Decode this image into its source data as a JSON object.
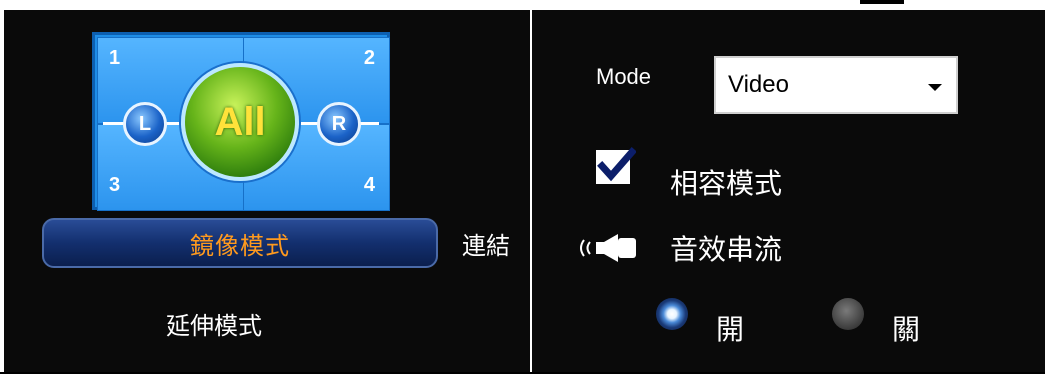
{
  "layout_grid": {
    "quadrants": [
      "1",
      "2",
      "3",
      "4"
    ],
    "left_badge": "L",
    "right_badge": "R",
    "center_badge": "All"
  },
  "mirror_mode_label": "鏡像模式",
  "link_label": "連結",
  "extend_mode_label": "延伸模式",
  "mode": {
    "label": "Mode",
    "selected": "Video"
  },
  "compat_mode": {
    "label": "相容模式",
    "checked": true
  },
  "audio_stream": {
    "label": "音效串流",
    "icon": "speaker-icon",
    "on_label": "開",
    "off_label": "關",
    "selected": "開"
  },
  "colors": {
    "accent_orange": "#ff9a1e",
    "grid_blue": "#2c94ee",
    "button_navy": "#132f6e"
  }
}
